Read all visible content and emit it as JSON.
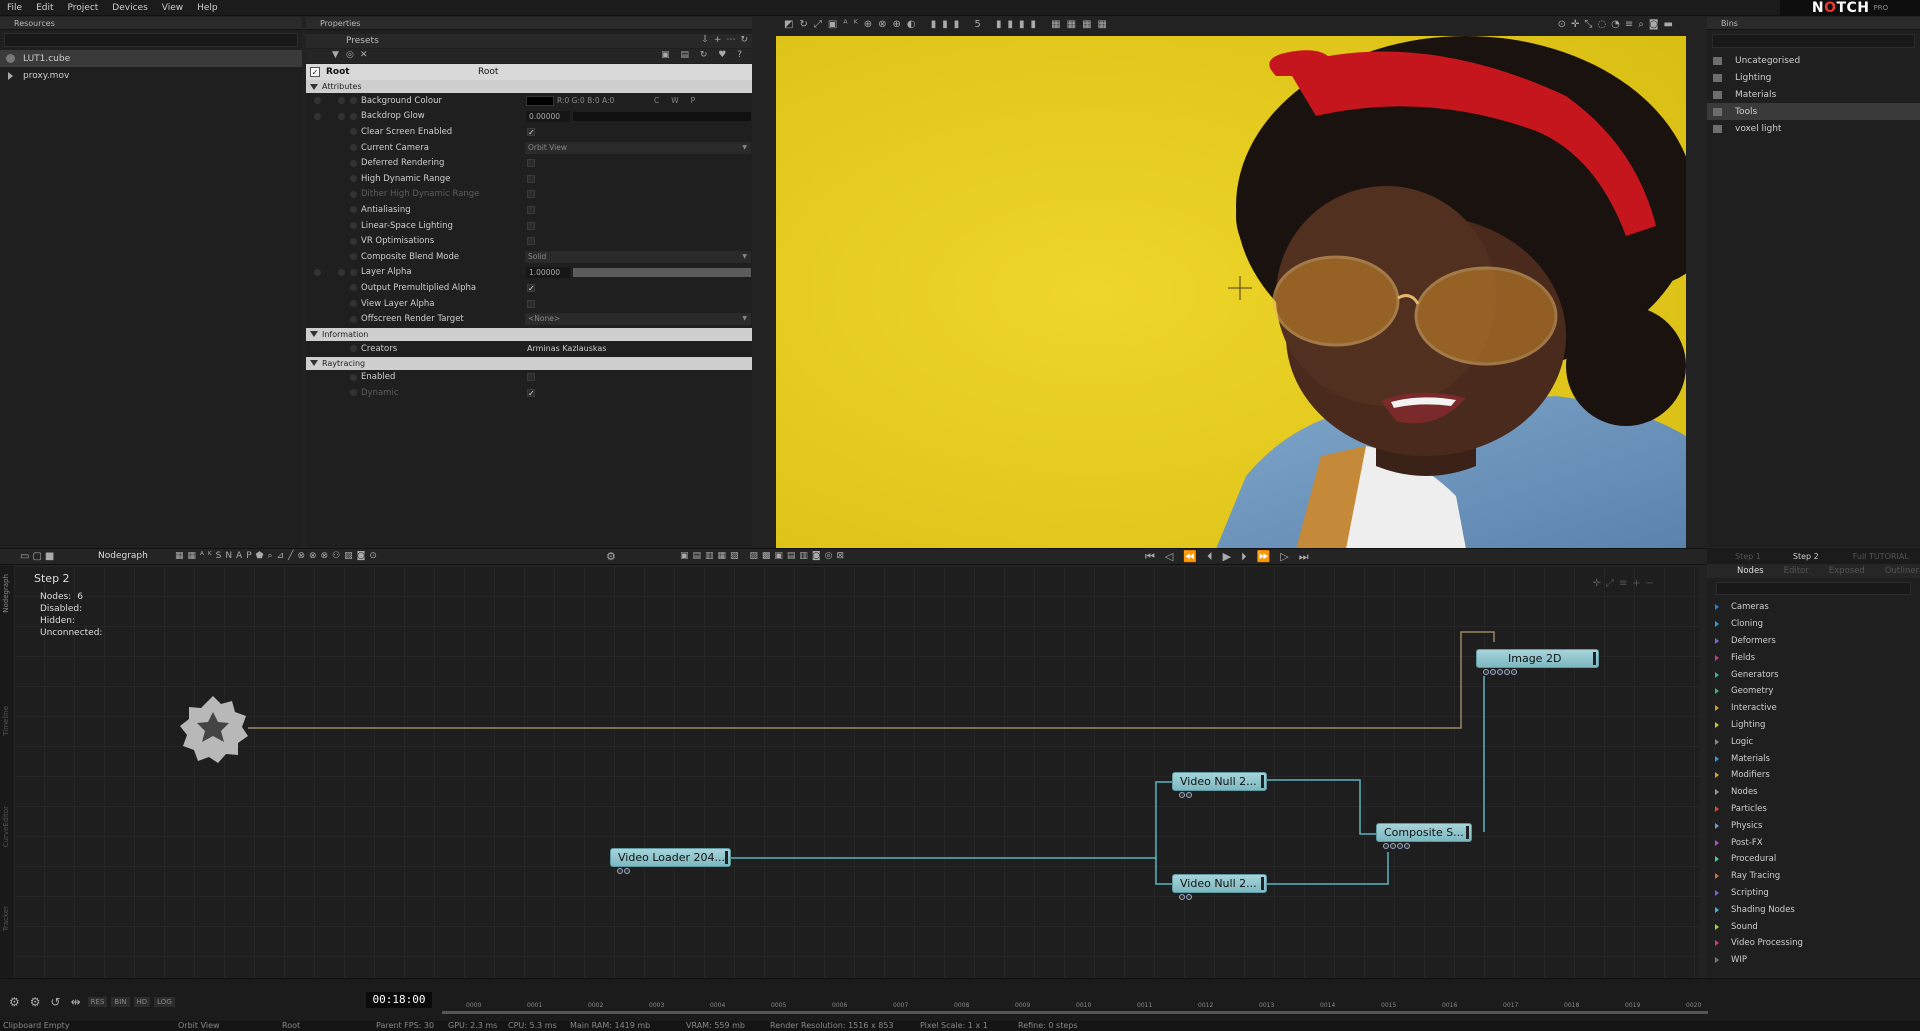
{
  "menu": [
    "File",
    "Edit",
    "Project",
    "Devices",
    "View",
    "Help"
  ],
  "logo": {
    "brand_pre": "N",
    "brand_accent": "O",
    "brand_post": "TCH",
    "edition": "PRO"
  },
  "resources": {
    "title": "Resources",
    "items": [
      {
        "label": "LUT1.cube",
        "selected": true
      },
      {
        "label": "proxy.mov",
        "selected": false
      }
    ]
  },
  "properties": {
    "title": "Properties",
    "presets_label": "Presets",
    "root": {
      "label": "Root",
      "value": "Root"
    },
    "attributes_section": "Attributes",
    "rows": [
      {
        "label": "Background Colour",
        "kind": "color",
        "value": "R:0 G:0 B:0 A:0",
        "extra": [
          "C",
          "W",
          "P"
        ]
      },
      {
        "label": "Backdrop Glow",
        "kind": "slider",
        "value": "0.00000",
        "fill": 0
      },
      {
        "label": "Clear Screen Enabled",
        "kind": "check",
        "checked": true
      },
      {
        "label": "Current Camera",
        "kind": "dropdown",
        "value": "Orbit View"
      },
      {
        "label": "Deferred Rendering",
        "kind": "check",
        "checked": false
      },
      {
        "label": "High Dynamic Range",
        "kind": "check",
        "checked": false
      },
      {
        "label": "Dither High Dynamic Range",
        "kind": "check",
        "checked": false,
        "dim": true
      },
      {
        "label": "Antialiasing",
        "kind": "check",
        "checked": false
      },
      {
        "label": "Linear-Space Lighting",
        "kind": "check",
        "checked": false
      },
      {
        "label": "VR Optimisations",
        "kind": "check",
        "checked": false
      },
      {
        "label": "Composite Blend Mode",
        "kind": "dropdown",
        "value": "Solid"
      },
      {
        "label": "Layer Alpha",
        "kind": "slider",
        "value": "1.00000",
        "fill": 1
      },
      {
        "label": "Output Premultiplied Alpha",
        "kind": "check",
        "checked": true
      },
      {
        "label": "View Layer Alpha",
        "kind": "check",
        "checked": false
      },
      {
        "label": "Offscreen Render Target",
        "kind": "dropdown",
        "value": "<None>"
      }
    ],
    "information_section": "Information",
    "creators_label": "Creators",
    "creators_value": "Arminas Kazlauskas",
    "raytracing_section": "Raytracing",
    "ray_rows": [
      {
        "label": "Enabled",
        "checked": false,
        "dim": false
      },
      {
        "label": "Dynamic",
        "checked": true,
        "dim": true
      }
    ]
  },
  "bins": {
    "title": "Bins",
    "items": [
      {
        "label": "Uncategorised",
        "selected": false
      },
      {
        "label": "Lighting",
        "selected": false
      },
      {
        "label": "Materials",
        "selected": false
      },
      {
        "label": "Tools",
        "selected": true
      },
      {
        "label": "voxel light",
        "selected": false
      }
    ]
  },
  "nodegraph": {
    "title": "Nodegraph",
    "step": "Step  2",
    "stats": [
      {
        "label": "Nodes:",
        "value": "6"
      },
      {
        "label": "Disabled:",
        "value": ""
      },
      {
        "label": "Hidden:",
        "value": ""
      },
      {
        "label": "Unconnected:",
        "value": ""
      }
    ],
    "side_tabs": [
      "Nodegraph",
      "Timeline",
      "CurveEditor",
      "Tracker"
    ],
    "nodes": {
      "image2d": "Image  2D",
      "video_null_1": "Video  Null  2...",
      "video_null_2": "Video  Null  2...",
      "composite": "Composite  S...",
      "video_loader": "Video  Loader  204..."
    }
  },
  "nodes_panel": {
    "tabs": [
      "Step 1",
      "Step 2",
      "Full TUTORIAL"
    ],
    "active_tab": "Step 2",
    "subtabs": [
      "Nodes",
      "Editor",
      "Exposed",
      "Outliner"
    ],
    "active_subtab": "Nodes",
    "categories": [
      "Cameras",
      "Cloning",
      "Deformers",
      "Fields",
      "Generators",
      "Geometry",
      "Interactive",
      "Lighting",
      "Logic",
      "Materials",
      "Modifiers",
      "Nodes",
      "Particles",
      "Physics",
      "Post-FX",
      "Procedural",
      "Ray Tracing",
      "Scripting",
      "Shading Nodes",
      "Sound",
      "Video Processing",
      "WIP"
    ],
    "category_colors": {
      "Cameras": "#2a7bd6",
      "Cloning": "#2aa0d6",
      "Deformers": "#7a6ad6",
      "Fields": "#c43a8a",
      "Generators": "#2ab6a0",
      "Geometry": "#3ab66a",
      "Interactive": "#d69a2a",
      "Lighting": "#d6c32a",
      "Logic": "#888888",
      "Materials": "#3a9ad6",
      "Modifiers": "#d6a02a",
      "Nodes": "#9a9a9a",
      "Particles": "#d64a3a",
      "Physics": "#6a9ad6",
      "Post-FX": "#b64ad6",
      "Procedural": "#3ad69a",
      "Ray Tracing": "#d66a3a",
      "Scripting": "#6a6ad6",
      "Shading Nodes": "#3ab6d6",
      "Sound": "#9ad63a",
      "Video Processing": "#d63a6a",
      "WIP": "#777777"
    }
  },
  "timeline": {
    "buttons": [
      "RES",
      "BIN",
      "HD",
      "LOG"
    ],
    "time": "00:18:00",
    "ticks": [
      "0000",
      "0001",
      "0002",
      "0003",
      "0004",
      "0005",
      "0006",
      "0007",
      "0008",
      "0009",
      "0010",
      "0011",
      "0012",
      "0013",
      "0014",
      "0015",
      "0016",
      "0017",
      "0018",
      "0019",
      "0020"
    ]
  },
  "status": {
    "clipboard": "Clipboard Empty",
    "camera": "Orbit View",
    "layer": "Root",
    "fps": "Parent  FPS: 30",
    "gpu": "GPU: 2.3 ms",
    "cpu": "CPU: 5.3 ms",
    "ram": "Main RAM: 1419 mb",
    "vram": "VRAM: 559 mb",
    "resolution": "Render Resolution: 1516 x 853",
    "pixel_scale": "Pixel Scale: 1 x 1",
    "refine": "Refine: 0 steps"
  },
  "colors": {
    "viewport_bg": "#e8cf21",
    "node_fill": "#8fc4cc",
    "wire": "#5fb3bd",
    "accent_red": "#e43a2f"
  }
}
